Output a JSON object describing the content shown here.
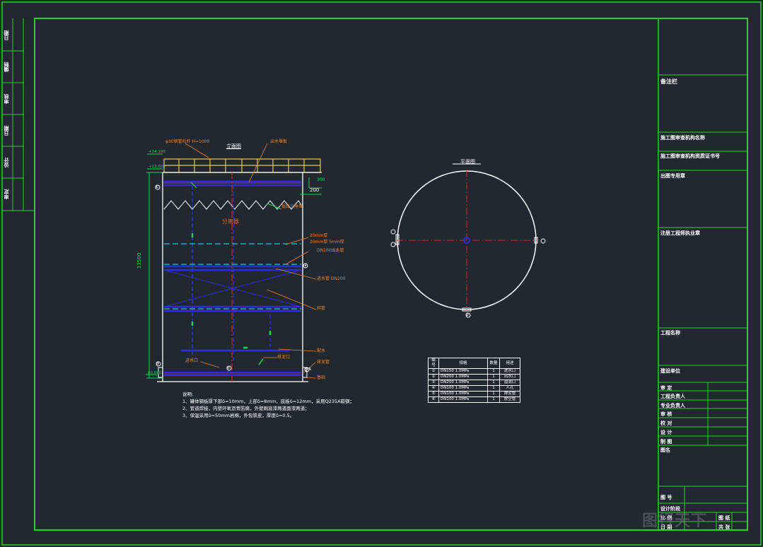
{
  "colors": {
    "background": "#212830",
    "frame": "#1ed61e",
    "outline": "#ffffff",
    "dimension": "#19d64a",
    "rail": "#e6c84a",
    "pipe_blue": "#2d2de0",
    "pipe_cyan": "#1ec8d8",
    "leader": "#f08020",
    "centerline": "#e02020"
  },
  "side_strip": {
    "labels": [
      "日期",
      "编制",
      "审核",
      "日期",
      "设计",
      "审定"
    ]
  },
  "views": {
    "elevation_title": "立面图",
    "plan_title": "平面图",
    "splitter_label": "分离器",
    "height_dim": "13500",
    "dim_200": "200",
    "dim_top": "300",
    "level_top": "+14.100",
    "level_mid": "+13.600",
    "level_bottom": "±0.000",
    "callouts": {
      "rail": "φ30钢管栏杆 H=1000",
      "weir": "出水堰板",
      "sawtooth": "锯齿三角堰",
      "w1": "20mm厚",
      "w2": "20mm厚 5mm厚",
      "w3": "DN100出水管",
      "w4": "进水管 DN200",
      "w5": "斜管",
      "w6": "配水",
      "w7": "排泥口",
      "w8": "进水口",
      "w9": "排泥管",
      "w10": "基础"
    },
    "markers": [
      "①",
      "②",
      "③",
      "④",
      "⑤",
      "⑥"
    ],
    "section_mark": "A"
  },
  "notes": {
    "heading": "说明:",
    "lines": [
      "1、罐体钢板厚下部δ=10mm，上部δ=8mm，底板δ=12mm，采用Q235A碳钢；",
      "2、管道焊接，内壁环氧沥青防腐，外壁刷底漆两道面漆两道；",
      "3、保温采用δ=50mm岩棉，外包铁皮，厚度δ=0.5。"
    ]
  },
  "pipe_table": {
    "headers": [
      "编号",
      "规格",
      "数量",
      "用途"
    ],
    "rows": [
      [
        "①",
        "DN150 1.0MPa",
        "1",
        "进水口"
      ],
      [
        "②",
        "DN200 1.0MPa",
        "1",
        "出水口"
      ],
      [
        "③",
        "DN200 1.0MPa",
        "1",
        "溢流口"
      ],
      [
        "④",
        "DN100 1.0MPa",
        "1",
        "人孔"
      ],
      [
        "⑤",
        "DN100 1.0MPa",
        "1",
        "排泥管"
      ],
      [
        "⑥",
        "DN100 1.0MPa",
        "1",
        "放空管"
      ]
    ]
  },
  "title_block": {
    "box1": "备注栏",
    "row1": "施工图审查机构名称",
    "row2": "施工图审查机构资质证书号",
    "box2": "出图专用章",
    "box3": "注册工程师执业章",
    "project": "工程名称",
    "unit": "建设单位",
    "sign_rows": [
      {
        "a": "审    定",
        "b": ""
      },
      {
        "a": "工程负责人",
        "b": ""
      },
      {
        "a": "专业负责人",
        "b": ""
      },
      {
        "a": "审    核",
        "b": ""
      },
      {
        "a": "校    对",
        "b": ""
      },
      {
        "a": "设    计",
        "b": ""
      },
      {
        "a": "制    图",
        "b": ""
      }
    ],
    "drawing_name": "图名",
    "bottom_rows": [
      {
        "a": "图    号",
        "b": ""
      },
      {
        "a": "设计阶段",
        "b": ""
      },
      {
        "a": "比    例",
        "b": "图    纸"
      },
      {
        "a": "日    期",
        "b": "共    张"
      }
    ]
  },
  "watermark": "图行天下"
}
